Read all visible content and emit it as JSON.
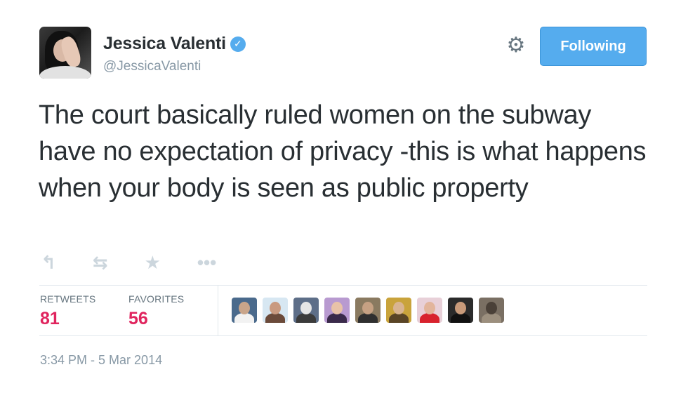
{
  "user": {
    "display_name": "Jessica Valenti",
    "handle": "@JessicaValenti",
    "verified": true,
    "verified_icon": "verified-badge-icon"
  },
  "header": {
    "settings_icon": "gear-icon",
    "follow_label": "Following",
    "follow_color": "#55acee"
  },
  "tweet": {
    "text": "The court basically ruled women on the subway have no expectation of privacy -this is what happens when your body is seen as public property"
  },
  "actions": [
    {
      "name": "reply-icon",
      "glyph": "↰"
    },
    {
      "name": "retweet-icon",
      "glyph": "⇆"
    },
    {
      "name": "favorite-star-icon",
      "glyph": "★"
    },
    {
      "name": "more-icon",
      "glyph": "•••"
    }
  ],
  "stats": {
    "retweets_label": "RETWEETS",
    "retweets_count": "81",
    "favorites_label": "FAVORITES",
    "favorites_count": "56",
    "count_color": "#e0245e"
  },
  "favoriters": [
    {
      "name": "favoriter-avatar-1",
      "bg": "#4a6a8c",
      "head": "#c9a58a",
      "body": "#f2f2f2"
    },
    {
      "name": "favoriter-avatar-2",
      "bg": "#d7e7f2",
      "head": "#c99a80",
      "body": "#6b4a3a"
    },
    {
      "name": "favoriter-avatar-3",
      "bg": "#5d6e88",
      "head": "#e5e5e5",
      "body": "#3b3b3b"
    },
    {
      "name": "favoriter-avatar-4",
      "bg": "#b89ad0",
      "head": "#e8c2a8",
      "body": "#3a2a4a"
    },
    {
      "name": "favoriter-avatar-5",
      "bg": "#8a7a60",
      "head": "#c6a183",
      "body": "#2f2f2f"
    },
    {
      "name": "favoriter-avatar-6",
      "bg": "#c9a33b",
      "head": "#d9b490",
      "body": "#5a4526"
    },
    {
      "name": "favoriter-avatar-7",
      "bg": "#e8d0d8",
      "head": "#e2b59c",
      "body": "#d8222d"
    },
    {
      "name": "favoriter-avatar-8",
      "bg": "#2b2b2b",
      "head": "#c89a7a",
      "body": "#111111"
    },
    {
      "name": "favoriter-avatar-9",
      "bg": "#7a6f63",
      "head": "#4a4038",
      "body": "#9c8f7e"
    }
  ],
  "meta": {
    "timestamp": "3:34 PM - 5 Mar 2014"
  }
}
